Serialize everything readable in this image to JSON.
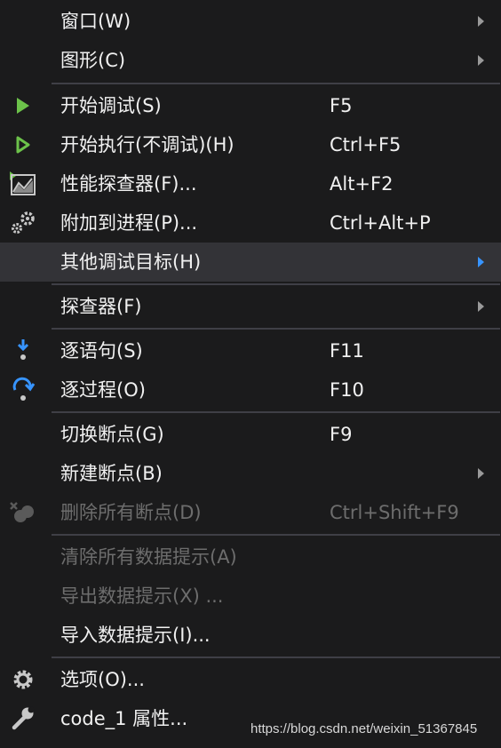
{
  "menu": {
    "items": [
      {
        "label": "窗口(W)",
        "shortcut": "",
        "icon": "",
        "submenu": true,
        "enabled": true
      },
      {
        "label": "图形(C)",
        "shortcut": "",
        "icon": "",
        "submenu": true,
        "enabled": true
      },
      {
        "label": "开始调试(S)",
        "shortcut": "F5",
        "icon": "play-solid-icon",
        "submenu": false,
        "enabled": true
      },
      {
        "label": "开始执行(不调试)(H)",
        "shortcut": "Ctrl+F5",
        "icon": "play-outline-icon",
        "submenu": false,
        "enabled": true
      },
      {
        "label": "性能探查器(F)...",
        "shortcut": "Alt+F2",
        "icon": "performance-chart-icon",
        "submenu": false,
        "enabled": true
      },
      {
        "label": "附加到进程(P)...",
        "shortcut": "Ctrl+Alt+P",
        "icon": "gears-icon",
        "submenu": false,
        "enabled": true
      },
      {
        "label": "其他调试目标(H)",
        "shortcut": "",
        "icon": "",
        "submenu": true,
        "enabled": true,
        "highlighted": true
      },
      {
        "label": "探查器(F)",
        "shortcut": "",
        "icon": "",
        "submenu": true,
        "enabled": true
      },
      {
        "label": "逐语句(S)",
        "shortcut": "F11",
        "icon": "step-into-icon",
        "submenu": false,
        "enabled": true
      },
      {
        "label": "逐过程(O)",
        "shortcut": "F10",
        "icon": "step-over-icon",
        "submenu": false,
        "enabled": true
      },
      {
        "label": "切换断点(G)",
        "shortcut": "F9",
        "icon": "",
        "submenu": false,
        "enabled": true
      },
      {
        "label": "新建断点(B)",
        "shortcut": "",
        "icon": "",
        "submenu": true,
        "enabled": true
      },
      {
        "label": "删除所有断点(D)",
        "shortcut": "Ctrl+Shift+F9",
        "icon": "delete-breakpoints-icon",
        "submenu": false,
        "enabled": false
      },
      {
        "label": "清除所有数据提示(A)",
        "shortcut": "",
        "icon": "",
        "submenu": false,
        "enabled": false
      },
      {
        "label": "导出数据提示(X) ...",
        "shortcut": "",
        "icon": "",
        "submenu": false,
        "enabled": false
      },
      {
        "label": "导入数据提示(I)...",
        "shortcut": "",
        "icon": "",
        "submenu": false,
        "enabled": true
      },
      {
        "label": "选项(O)...",
        "shortcut": "",
        "icon": "gear-icon",
        "submenu": false,
        "enabled": true
      },
      {
        "label": "code_1 属性...",
        "shortcut": "",
        "icon": "wrench-icon",
        "submenu": false,
        "enabled": true
      }
    ]
  },
  "watermark": "https://blog.csdn.net/weixin_51367845",
  "colors": {
    "background": "#1b1b1c",
    "highlight": "#333337",
    "separator": "#3f3f46",
    "text": "#f1f1f1",
    "disabled_text": "#6d6d6d",
    "play_green": "#6cc24a",
    "step_blue": "#3794ff"
  }
}
